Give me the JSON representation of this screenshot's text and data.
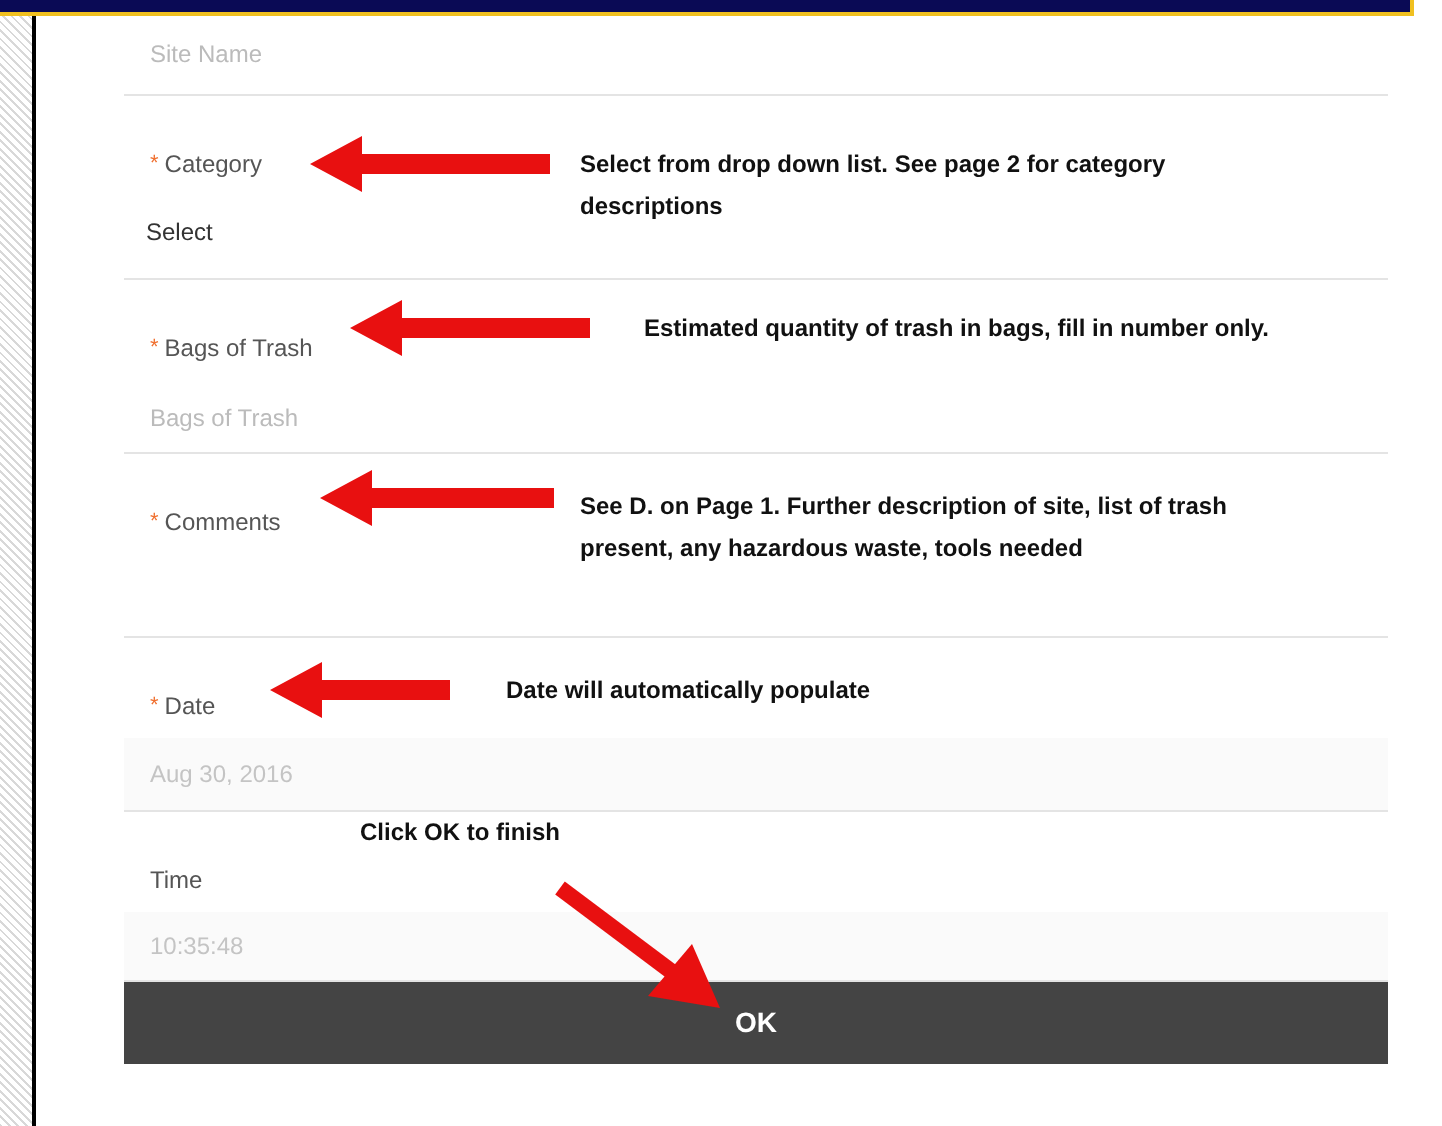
{
  "form": {
    "fields": [
      {
        "kind": "input",
        "placeholder": "Site Name"
      },
      {
        "kind": "select",
        "marker": "*",
        "label": "Category",
        "value": "Select",
        "note": "Select from drop down list. See page 2 for category descriptions"
      },
      {
        "kind": "input",
        "marker": "*",
        "label": "Bags of Trash",
        "placeholder": "Bags of Trash",
        "note": "Estimated quantity of trash in bags, fill in number only."
      },
      {
        "kind": "textarea",
        "marker": "*",
        "label": "Comments",
        "note": "See D. on Page 1. Further description of site, list of trash present, any hazardous waste, tools needed"
      },
      {
        "kind": "readonly",
        "marker": "*",
        "label": "Date",
        "placeholder": "Aug 30, 2016",
        "note": "Date will automatically populate"
      },
      {
        "kind": "readonly",
        "label": "Time",
        "placeholder": "10:35:48",
        "note": "Click OK to finish"
      }
    ],
    "button": {
      "label": "OK"
    }
  }
}
